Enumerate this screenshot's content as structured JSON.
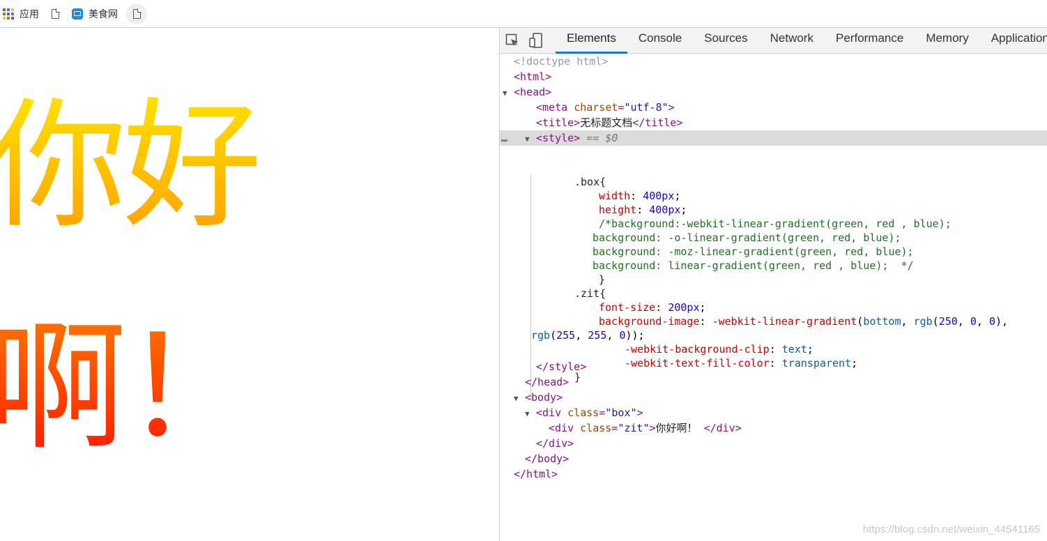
{
  "bookmarks": {
    "apps_label": "应用",
    "site_label": "美食网"
  },
  "page": {
    "zit_text_line1": "你好",
    "zit_text_line2": "啊！",
    "gradient_top": "#fff200",
    "gradient_bottom": "#ff0000"
  },
  "devtools": {
    "tabs": [
      "Elements",
      "Console",
      "Sources",
      "Network",
      "Performance",
      "Memory",
      "Application"
    ],
    "active_tab": "Elements",
    "dom": {
      "doctype": "<!doctype html>",
      "html_open": "<html>",
      "head_open": "<head>",
      "meta_tag": "meta",
      "meta_attr": "charset",
      "meta_val": "\"utf-8\"",
      "title_open": "<title>",
      "title_text": "无标题文档",
      "title_close": "</title>",
      "style_open": "<style>",
      "style_marker": "== $0",
      "style_close": "</style>",
      "head_close": "</head>",
      "body_open": "<body>",
      "div_tag": "div",
      "class_attr": "class",
      "box_val": "\"box\"",
      "zit_val": "\"zit\"",
      "zit_text": "你好啊！",
      "div_close": "</div>",
      "body_close": "</body>",
      "html_close": "</html>"
    },
    "css": {
      "box_selector": ".box{",
      "width_prop": "width",
      "width_val": "400px",
      "height_prop": "height",
      "height_val": "400px",
      "comment1": "/*background:-webkit-linear-gradient(green, red , blue);",
      "comment2": "background: -o-linear-gradient(green, red, blue);",
      "comment3": "background: -moz-linear-gradient(green, red, blue);",
      "comment4": "background: linear-gradient(green, red , blue);  */",
      "close1": "}",
      "zit_selector": ".zit{",
      "fs_prop": "font-size",
      "fs_val": "200px",
      "bgi_prop": "background-image",
      "bgi_fn": "-webkit-linear-gradient",
      "bgi_kw": "bottom",
      "rgb_fn": "rgb",
      "rgb1_a": "250",
      "rgb1_b": "0",
      "rgb1_c": "0",
      "rgb2_a": "255",
      "rgb2_b": "255",
      "rgb2_c": "0",
      "clip_prop": "-webkit-background-clip",
      "clip_val": "text",
      "fill_prop": "-webkit-text-fill-color",
      "fill_val": "transparent",
      "close2": "}"
    }
  },
  "watermark": "https://blog.csdn.net/weixin_44541165"
}
